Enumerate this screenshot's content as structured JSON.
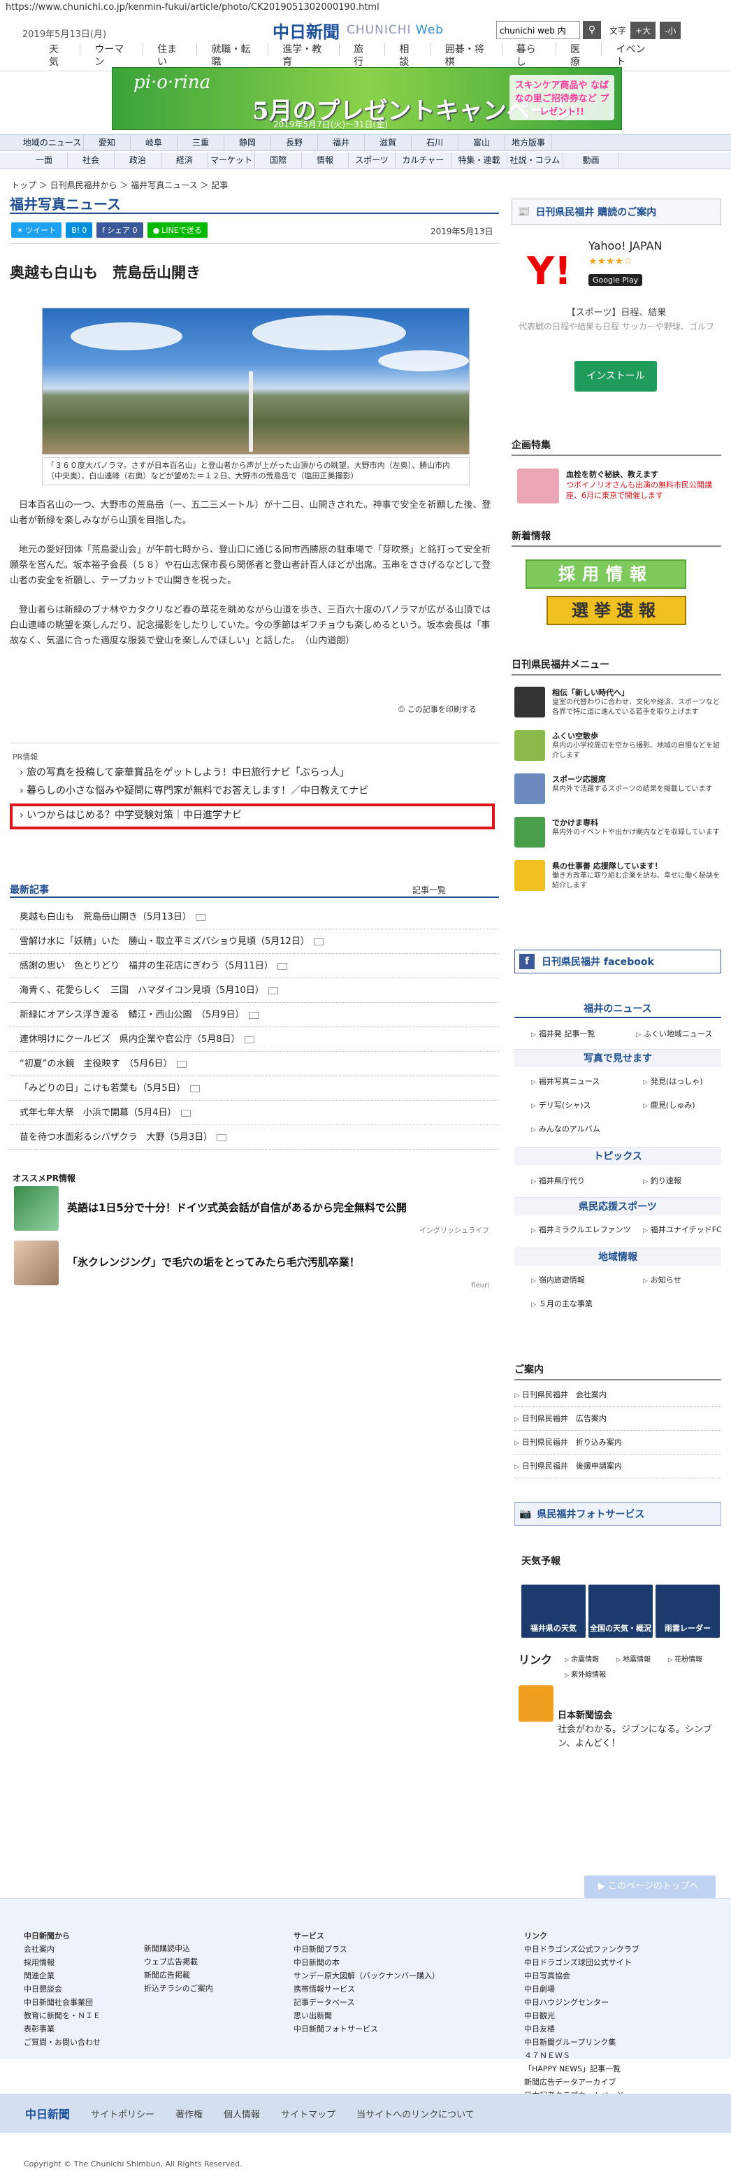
{
  "url": "https://www.chunichi.co.jp/kenmin-fukui/article/photo/CK2019051302000190.html",
  "header": {
    "date": "2019年5月13日(月)",
    "logo_jp": "中日新聞",
    "logo_en1": "CHUNICHI",
    "logo_en2": "Web",
    "search_value": "chunichi web 内",
    "font_label": "文字",
    "font_large": "+大",
    "font_small": "-小",
    "nav": [
      "天気",
      "ウーマン",
      "住まい",
      "就職・転職",
      "進学・教育",
      "旅行",
      "相談",
      "囲碁・将棋",
      "暮らし",
      "医療",
      "イベント"
    ]
  },
  "banner": {
    "brand": "pi·o·rina",
    "title": "5月のプレゼントキャンペーン",
    "period": "2019年5月7日(火)～31日(金)",
    "pink": "スキンケア商品や なばなの里ご招待券など プレゼント!!"
  },
  "regnav": [
    "地域のニュース",
    "愛知",
    "岐阜",
    "三重",
    "静岡",
    "長野",
    "福井",
    "滋賀",
    "石川",
    "富山",
    "地方版事"
  ],
  "catnav": [
    "一面",
    "社会",
    "政治",
    "経済",
    "マーケット",
    "国際",
    "情報",
    "スポーツ",
    "カルチャー",
    "特集・連載",
    "社説・コラム",
    "動画"
  ],
  "breadcrumb": "トップ ＞ 日刊県民福井から ＞ 福井写真ニュース ＞ 記事",
  "section_title": "福井写真ニュース",
  "social": {
    "tweet": "ツイート",
    "hatena": "0",
    "facebook": "シェア 0",
    "line": "LINEで送る"
  },
  "pub_date": "2019年5月13日",
  "headline": "奥越も白山も　荒島岳山開き",
  "caption": "「３６０度大パノラマ。さすが日本百名山」と登山者から声が上がった山頂からの眺望。大野市内（左奥）、勝山市内（中央奥）、白山連峰（右奥）などが望めた＝１２日、大野市の荒島岳で（塩田正美撮影）",
  "paras": [
    "日本百名山の一つ、大野市の荒島岳（一、五二三メートル）が十二日、山開きされた。神事で安全を祈願した後、登山者が新緑を楽しみながら山頂を目指した。",
    "地元の愛好団体「荒島愛山会」が午前七時から、登山口に通じる同市西勝原の駐車場で「芽吹祭」と銘打って安全祈願祭を営んだ。坂本裕子会長（５８）や石山志保市長ら関係者と登山者計百人ほどが出席。玉串をささげるなどして登山者の安全を祈願し、テープカットで山開きを祝った。",
    "登山者らは新緑のブナ林やカタクリなど春の草花を眺めながら山道を歩き、三百六十度のパノラマが広がる山頂では白山連峰の眺望を楽しんだり、記念撮影をしたりしていた。今の季節はギフチョウも楽しめるという。坂本会長は「事故なく、気温に合った適度な服装で登山を楽しんでほしい」と話した。　（山内道朗）"
  ],
  "print_label": "この記事を印刷する",
  "pr": {
    "label": "PR情報",
    "links": [
      "旅の写真を投稿して豪華賞品をゲットしよう！中日旅行ナビ「ぶらっ人」",
      "暮らしの小さな悩みや疑問に専門家が無料でお答えします！／中日教えてナビ",
      "いつからはじめる？中学受験対策｜中日進学ナビ"
    ]
  },
  "recent": {
    "title": "最新記事",
    "list_label": "記事一覧",
    "items": [
      "奥越も白山も　荒島岳山開き（5月13日）",
      "雪解け水に「妖精」いた　勝山・取立平ミズバショウ見頃（5月12日）",
      "感謝の思い　色とりどり　福井の生花店にぎわう（5月11日）",
      "海青く、花愛らしく　三国　ハマダイコン見頃（5月10日）",
      "新緑にオアシス浮き渡る　鯖江・西山公園　（5月9日）",
      "連休明けにクールビズ　県内企業や官公庁（5月8日）",
      "“初夏”の水鏡　主役映す　（5月6日）",
      "「みどりの日」こけも若葉も（5月5日）",
      "式年七年大祭　小浜で開幕（5月4日）",
      "苗を待つ水面彩るシバザクラ　大野（5月3日）"
    ]
  },
  "osusume": {
    "label": "オススメPR情報",
    "items": [
      {
        "title": "英語は1日5分で十分！ドイツ式英会話が自信があるから完全無料で公開",
        "source": "イングリッシュライフ"
      },
      {
        "title": "「氷クレンジング」で毛穴の垢をとってみたら毛穴汚肌卒業！",
        "source": "fleuri"
      }
    ]
  },
  "side": {
    "subscribe": "日刊県民福井 購読のご案内",
    "yahoo": {
      "name": "Yahoo! JAPAN",
      "stars": "★★★★☆",
      "store": "Google Play",
      "desc1": "【スポーツ】日程、結果",
      "desc2": "代表戦の日程や結果も日程 サッカーや野球、ゴルフ",
      "install": "インストール"
    },
    "kikaku_h": "企画特集",
    "kikaku_t1": "血栓を防ぐ秘訣、教えます",
    "kikaku_t2": "つボイノリオさんも出演の無料市民公開講座、6月に東京で開催します",
    "shinchaku_h": "新着情報",
    "saiyo": "採用情報",
    "senkyo": "選挙速報",
    "menu_h": "日刊県民福井メニュー",
    "menu": [
      {
        "t": "相伝「新しい時代へ」",
        "d": "皇室の代替わりに合わせ、文化や経済、スポーツなど各界で特に道に進んでいる若手を取り上げます"
      },
      {
        "t": "ふくい空散歩",
        "d": "県内の小学校周辺を空から撮影、地域の自慢などを紹介します"
      },
      {
        "t": "スポーツ応援席",
        "d": "県内外で活躍するスポーツの結果を掲載しています"
      },
      {
        "t": "でかけま専科",
        "d": "県内外のイベントや出かけ案内などを収録しています"
      },
      {
        "t": "県の仕事善 応援隊しています！",
        "d": "働き方改革に取り組む企業を訪ね、幸せに働く秘訣を紹介します"
      }
    ],
    "facebook": "日刊県民福井 facebook",
    "news_h": "福井のニュース",
    "news_links": [
      "福井発 記事一覧",
      "ふくい地域ニュース"
    ],
    "photo_h": "写真で見せます",
    "photo_links": [
      "福井写真ニュース",
      "発見(はっしゃ)",
      "デリ写(シャ)ス",
      "鹿見(しゅみ)",
      "みんなのアルバム"
    ],
    "topics_h": "トピックス",
    "topics_links": [
      "福井県庁代り",
      "釣り速報"
    ],
    "sports_h": "県民応援スポーツ",
    "sports_links": [
      "福井ミラクルエレファンツ",
      "福井ユナイテッドFC"
    ],
    "chiiki_h": "地域情報",
    "chiiki_links": [
      "嶺内旅遊情報",
      "お知らせ",
      "５月の主な事業"
    ],
    "annai_h": "ご案内",
    "annai": [
      "日刊県民福井　会社案内",
      "日刊県民福井　広告案内",
      "日刊県民福井　折り込み案内",
      "日刊県民福井　後援申請案内"
    ],
    "photosvc": "県民福井フォトサービス",
    "weather_h": "天気予報",
    "weather": [
      "福井県の天気",
      "全国の天気・概況",
      "雨雲レーダー"
    ],
    "link_h": "リンク",
    "links": [
      "余震情報",
      "地震情報",
      "花粉情報",
      "紫外線情報"
    ],
    "nihon_t": "日本新聞協会",
    "nihon_d": "社会がわかる。ジブンになる。シンブン、よんどく！"
  },
  "totop": "このページのトップへ",
  "footer": {
    "col1_h": "中日新聞から",
    "col1": [
      "会社案内",
      "採用情報",
      "関連企業",
      "中日懇談会",
      "中日新聞社会事業団",
      "教育に新聞を・ＮＩＥ",
      "表彰事業",
      "ご質問・お問い合わせ"
    ],
    "col2": [
      "新聞購読申込",
      "ウェブ広告掲載",
      "新聞広告掲載",
      "折込チラシのご案内"
    ],
    "col3_h": "サービス",
    "col3": [
      "中日新聞プラス",
      "中日新聞の本",
      "サンデー原大図解（パックナンバー購入）",
      "携帯情報サービス",
      "記事データベース",
      "思い出新聞",
      "中日新聞フォトサービス"
    ],
    "col4_h": "リンク",
    "col4": [
      "中日ドラゴンズ公式ファンクラブ",
      "中日ドラゴンズ球団公式サイト",
      "中日写真協会",
      "中日劇場",
      "中日ハウジングセンター",
      "中日観光",
      "中日友楼",
      "中日新聞グループリンク集",
      "４７ＮＥＷＳ",
      "「HAPPY NEWS」記事一覧",
      "新聞広告データアーカイブ",
      "日本記者クラブホームページ"
    ],
    "bar": [
      "中日新聞",
      "サイトポリシー",
      "著作権",
      "個人情報",
      "サイトマップ",
      "当サイトへのリンクについて"
    ],
    "copyright": "Copyright © The Chunichi Shimbun, All Rights Reserved."
  }
}
